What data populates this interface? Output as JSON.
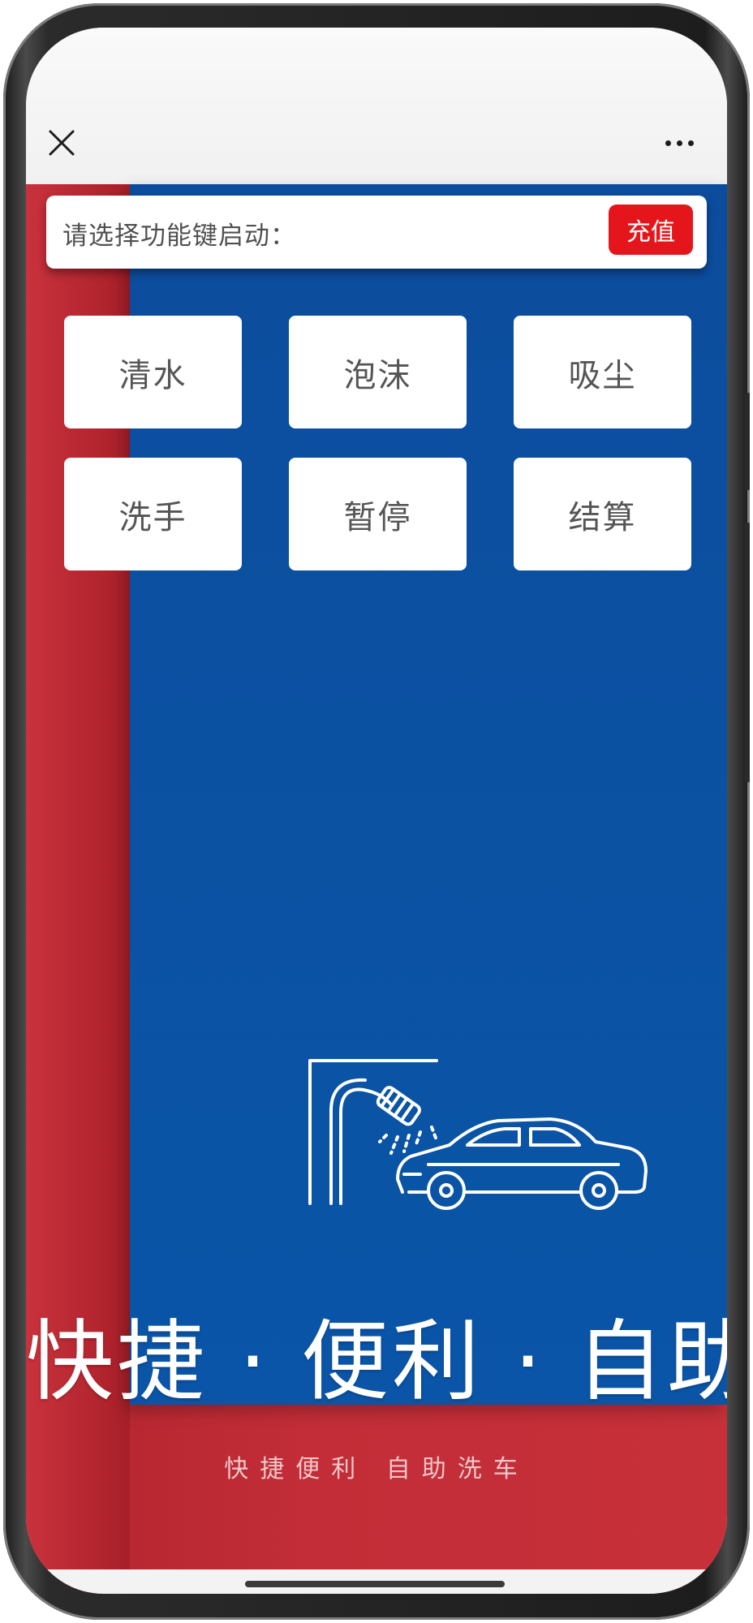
{
  "nav": {
    "close_icon": "close-icon",
    "more_icon": "more-icon"
  },
  "prompt": {
    "text": "请选择功能键启动：",
    "recharge_label": "充值"
  },
  "functions": [
    {
      "label": "清水"
    },
    {
      "label": "泡沫"
    },
    {
      "label": "吸尘"
    },
    {
      "label": "洗手"
    },
    {
      "label": "暂停"
    },
    {
      "label": "结算"
    }
  ],
  "banner": {
    "slogan": "快捷 · 便利 · 自助",
    "subslogan": "快捷便利  自助洗车",
    "illustration_icon": "car-wash-icon"
  },
  "colors": {
    "blue_panel": "#0b52a3",
    "red_background": "#c22d37",
    "recharge_button": "#e5151c"
  }
}
